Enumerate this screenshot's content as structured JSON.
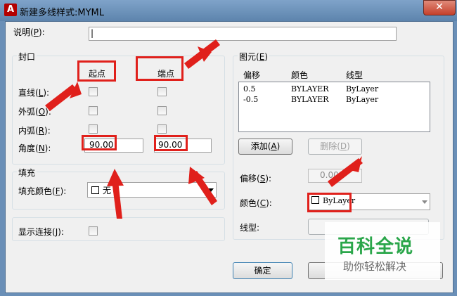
{
  "window": {
    "title": "新建多线样式:MYML",
    "close_glyph": "✕",
    "app_glyph": "A"
  },
  "description": {
    "label": "说明(",
    "key": "P",
    "suffix": "):",
    "value": "|"
  },
  "cap": {
    "title": "封口",
    "col_start": "起点",
    "col_end": "端点",
    "rows": [
      {
        "label": "直线(",
        "key": "L",
        "suffix": "):"
      },
      {
        "label": "外弧(",
        "key": "O",
        "suffix": "):"
      },
      {
        "label": "内弧(",
        "key": "R",
        "suffix": "):"
      }
    ],
    "angle_label": "角度(",
    "angle_key": "N",
    "angle_suffix": "):",
    "angle_start": "90.00",
    "angle_end": "90.00"
  },
  "fill": {
    "title": "填充",
    "color_label": "填充颜色(",
    "color_key": "F",
    "color_suffix": "):",
    "color_value": "无"
  },
  "show_joints": {
    "label": "显示连接(",
    "key": "J",
    "suffix": "):"
  },
  "elements": {
    "title": "图元(",
    "title_key": "E",
    "title_suffix": ")",
    "headers": [
      "偏移",
      "颜色",
      "线型"
    ],
    "rows": [
      {
        "offset": "0.5",
        "color": "BYLAYER",
        "linetype": "ByLayer"
      },
      {
        "offset": "-0.5",
        "color": "BYLAYER",
        "linetype": "ByLayer"
      }
    ],
    "add_label": "添加(",
    "add_key": "A",
    "add_suffix": ")",
    "delete_label": "删除(",
    "delete_key": "D",
    "delete_suffix": ")",
    "offset_label": "偏移(",
    "offset_key": "S",
    "offset_suffix": "):",
    "offset_value": "0.000",
    "color_label": "颜色(",
    "color_key": "C",
    "color_suffix": "):",
    "color_value": "ByLayer",
    "linetype_label": "线型:"
  },
  "buttons": {
    "ok": "确定"
  },
  "watermark": {
    "line1": "百科全说",
    "line2": "助你轻松解决"
  },
  "colors": {
    "annotation_red": "#e0201b",
    "watermark_green": "#2aa64a"
  }
}
